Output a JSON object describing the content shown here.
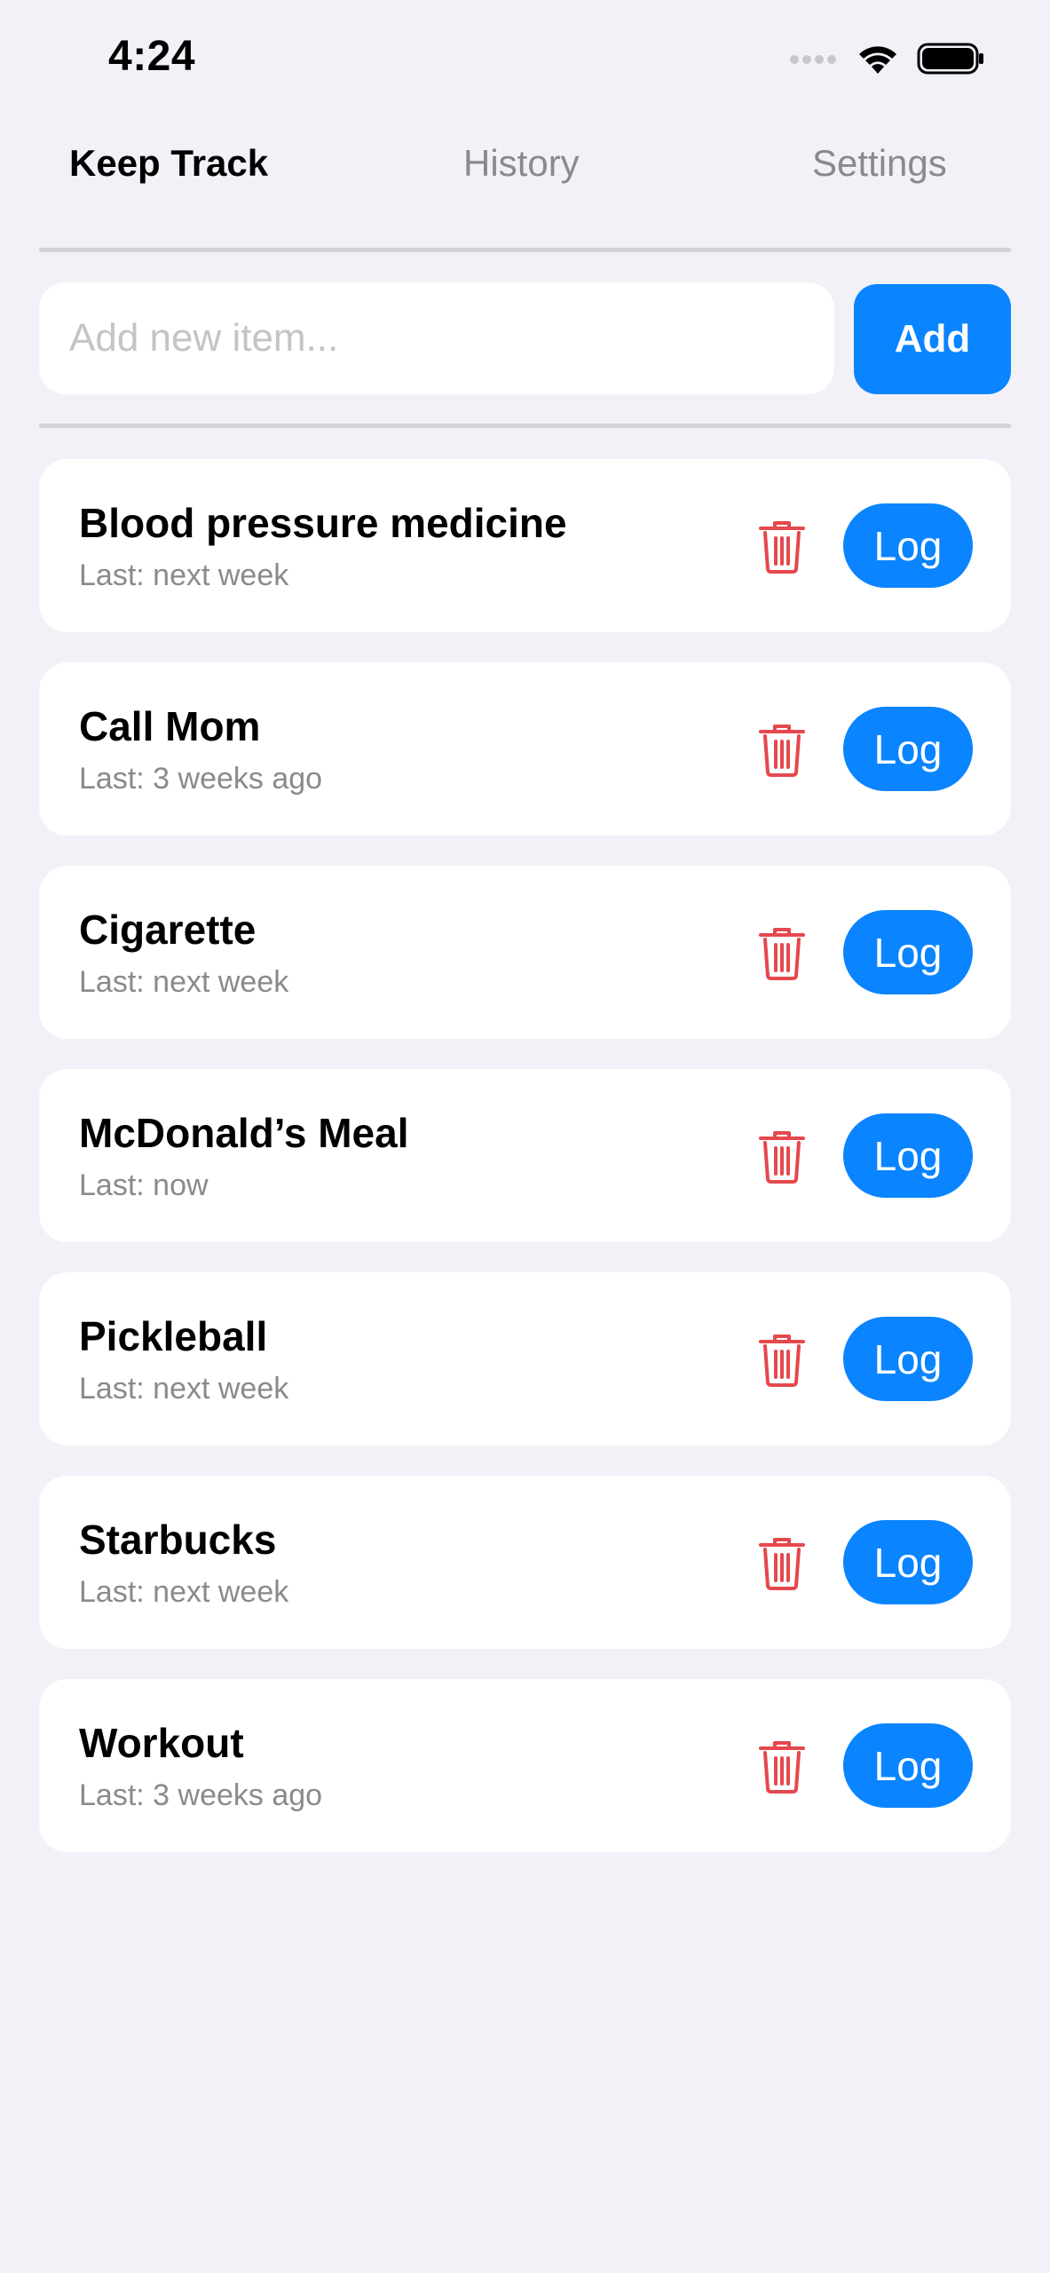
{
  "status_bar": {
    "time": "4:24",
    "icons": [
      "cellular-icon",
      "wifi-icon",
      "battery-icon"
    ]
  },
  "tabs": [
    {
      "label": "Keep Track",
      "active": true
    },
    {
      "label": "History",
      "active": false
    },
    {
      "label": "Settings",
      "active": false
    }
  ],
  "add_row": {
    "placeholder": "Add new item...",
    "value": "",
    "button_label": "Add"
  },
  "colors": {
    "accent": "#0a84ff",
    "delete": "#e5484d",
    "background": "#f1f1f7",
    "secondary_text": "#8a8a8e"
  },
  "items": [
    {
      "title": "Blood pressure medicine",
      "subtitle": "Last: next week",
      "log_label": "Log",
      "delete_icon": "trash-icon"
    },
    {
      "title": "Call Mom",
      "subtitle": "Last: 3 weeks ago",
      "log_label": "Log",
      "delete_icon": "trash-icon"
    },
    {
      "title": "Cigarette",
      "subtitle": "Last: next week",
      "log_label": "Log",
      "delete_icon": "trash-icon"
    },
    {
      "title": "McDonald’s Meal",
      "subtitle": "Last: now",
      "log_label": "Log",
      "delete_icon": "trash-icon"
    },
    {
      "title": "Pickleball",
      "subtitle": "Last: next week",
      "log_label": "Log",
      "delete_icon": "trash-icon"
    },
    {
      "title": "Starbucks",
      "subtitle": "Last: next week",
      "log_label": "Log",
      "delete_icon": "trash-icon"
    },
    {
      "title": "Workout",
      "subtitle": "Last: 3 weeks ago",
      "log_label": "Log",
      "delete_icon": "trash-icon"
    }
  ]
}
